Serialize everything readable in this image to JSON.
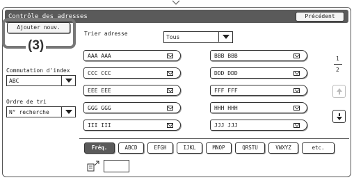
{
  "window": {
    "title": "Contrôle des adresses"
  },
  "header": {
    "prev_button": "Précédent"
  },
  "left": {
    "add_button": "Ajouter nouv.",
    "callout": "(3)",
    "commutation_label": "Commutation d'index",
    "commutation_value": "ABC",
    "ordre_label": "Ordre de tri",
    "ordre_value": "N° recherche"
  },
  "sort": {
    "label": "Trier adresse",
    "value": "Tous"
  },
  "addresses": [
    "AAA AAA",
    "BBB BBB",
    "CCC CCC",
    "DDD DDD",
    "EEE EEE",
    "FFF FFF",
    "GGG GGG",
    "HHH HHH",
    "III III",
    "JJJ JJJ"
  ],
  "pager": {
    "current": "1",
    "total": "2"
  },
  "tabs": [
    "Fréq.",
    "ABCD",
    "EFGH",
    "IJKL",
    "MNOP",
    "QRSTU",
    "VWXYZ",
    "etc."
  ],
  "icons": {
    "up": "up-arrow-icon",
    "down": "down-arrow-icon",
    "keyboard": "keyboard-icon",
    "mail": "envelope-icon"
  }
}
